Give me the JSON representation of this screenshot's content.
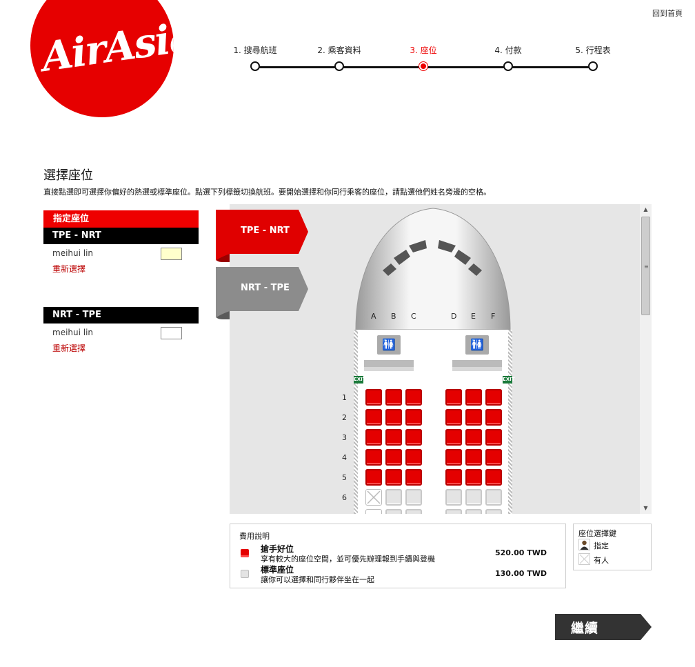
{
  "brand": {
    "logo_text": "AirAsia",
    "color": "#e60000"
  },
  "header": {
    "home_link": "回到首頁"
  },
  "steps": [
    {
      "label": "1. 搜尋航班",
      "active": false
    },
    {
      "label": "2. 乘客資料",
      "active": false
    },
    {
      "label": "3. 座位",
      "active": true
    },
    {
      "label": "4. 付款",
      "active": false
    },
    {
      "label": "5. 行程表",
      "active": false
    }
  ],
  "page": {
    "title": "選擇座位",
    "description": "直接點選即可選擇你偏好的熱選或標準座位。點選下列標籤切換航班。要開始選擇和你同行乘客的座位，請點選他們姓名旁邊的空格。"
  },
  "sidebar": {
    "header": "指定座位",
    "flights": [
      {
        "route": "TPE - NRT",
        "passenger": "meihui lin",
        "reselect": "重新選擇",
        "selected": true
      },
      {
        "route": "NRT - TPE",
        "passenger": "meihui lin",
        "reselect": "重新選擇",
        "selected": false
      }
    ]
  },
  "flight_tabs": [
    {
      "label": "TPE - NRT",
      "active": true,
      "color": "#e00000"
    },
    {
      "label": "NRT - TPE",
      "active": false,
      "color": "#8c8c8c"
    }
  ],
  "seatmap": {
    "columns_left": [
      "A",
      "B",
      "C"
    ],
    "columns_right": [
      "D",
      "E",
      "F"
    ],
    "lavatory_icon": "lavatory-icon",
    "exit_label": "EXIT",
    "rows": [
      {
        "num": "1",
        "seats": [
          "hot",
          "hot",
          "hot",
          "hot",
          "hot",
          "hot"
        ]
      },
      {
        "num": "2",
        "seats": [
          "hot",
          "hot",
          "hot",
          "hot",
          "hot",
          "hot"
        ]
      },
      {
        "num": "3",
        "seats": [
          "hot",
          "hot",
          "hot",
          "hot",
          "hot",
          "hot"
        ]
      },
      {
        "num": "4",
        "seats": [
          "hot",
          "hot",
          "hot",
          "hot",
          "hot",
          "hot"
        ]
      },
      {
        "num": "5",
        "seats": [
          "hot",
          "hot",
          "hot",
          "hot",
          "hot",
          "hot"
        ]
      },
      {
        "num": "6",
        "seats": [
          "taken",
          "std",
          "std",
          "std",
          "std",
          "std"
        ]
      }
    ]
  },
  "fees": {
    "title": "費用說明",
    "items": [
      {
        "type": "hot",
        "name": "搶手好位",
        "desc": "享有較大的座位空間，並可優先辦理報到手續與登機",
        "price": "520.00 TWD"
      },
      {
        "type": "std",
        "name": "標準座位",
        "desc": "讓你可以選擇和同行夥伴坐在一起",
        "price": "130.00 TWD"
      }
    ]
  },
  "legend": {
    "title": "座位選擇鍵",
    "items": [
      {
        "icon": "passenger-icon",
        "label": "指定"
      },
      {
        "icon": "occupied-x-icon",
        "label": "有人"
      }
    ]
  },
  "actions": {
    "continue": "繼續"
  }
}
